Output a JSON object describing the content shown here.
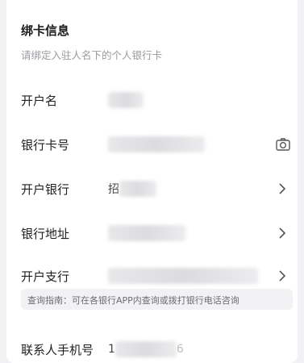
{
  "section": {
    "title": "绑卡信息",
    "subtitle": "请绑定入驻人名下的个人银行卡"
  },
  "fields": {
    "account_name": {
      "label": "开户名"
    },
    "card_number": {
      "label": "银行卡号",
      "icon": "camera-icon"
    },
    "bank": {
      "label": "开户银行",
      "visible_prefix": "招",
      "icon": "chevron-right-icon"
    },
    "bank_address": {
      "label": "银行地址",
      "icon": "chevron-right-icon"
    },
    "branch": {
      "label": "开户支行",
      "icon": "chevron-right-icon"
    },
    "contact_phone": {
      "label": "联系人手机号",
      "visible_prefix": "1",
      "visible_suffix": "6"
    }
  },
  "hint": {
    "text": "查询指南：可在各银行APP内查询或拨打银行电话咨询"
  },
  "colors": {
    "background": "#f2f2f4",
    "card": "#ffffff",
    "label": "#1f1f22",
    "muted": "#9b9b9f"
  }
}
